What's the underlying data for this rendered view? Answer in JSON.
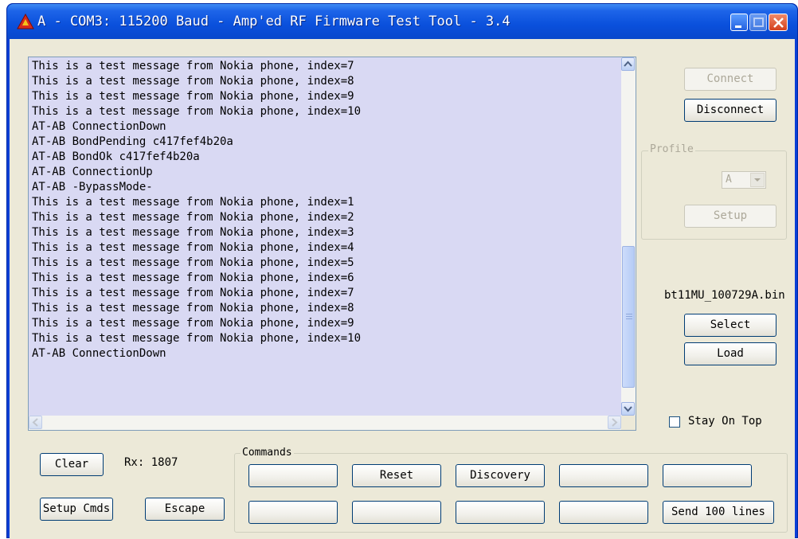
{
  "window": {
    "title": "A - COM3: 115200 Baud - Amp'ed RF Firmware Test Tool - 3.4"
  },
  "log": {
    "lines": [
      "This is a test message from Nokia phone, index=7",
      "This is a test message from Nokia phone, index=8",
      "This is a test message from Nokia phone, index=9",
      "This is a test message from Nokia phone, index=10",
      "AT-AB ConnectionDown",
      "AT-AB BondPending c417fef4b20a",
      "AT-AB BondOk c417fef4b20a",
      "AT-AB ConnectionUp",
      "AT-AB -BypassMode-",
      "This is a test message from Nokia phone, index=1",
      "This is a test message from Nokia phone, index=2",
      "This is a test message from Nokia phone, index=3",
      "This is a test message from Nokia phone, index=4",
      "This is a test message from Nokia phone, index=5",
      "This is a test message from Nokia phone, index=6",
      "This is a test message from Nokia phone, index=7",
      "This is a test message from Nokia phone, index=8",
      "This is a test message from Nokia phone, index=9",
      "This is a test message from Nokia phone, index=10",
      "AT-AB ConnectionDown"
    ]
  },
  "right_panel": {
    "connect_label": "Connect",
    "disconnect_label": "Disconnect",
    "profile_group_label": "Profile",
    "profile_value": "A",
    "setup_label": "Setup",
    "file_name": "bt11MU_100729A.bin",
    "select_label": "Select",
    "load_label": "Load",
    "stay_on_top_label": "Stay On Top"
  },
  "bottom": {
    "clear_label": "Clear",
    "rx_text": "Rx: 1807",
    "setup_cmds_label": "Setup Cmds",
    "escape_label": "Escape",
    "commands_group_label": "Commands",
    "commands_row1": [
      "",
      "Reset",
      "Discovery",
      "",
      ""
    ],
    "commands_row2": [
      "",
      "",
      "",
      "",
      "Send 100 lines"
    ]
  },
  "colors": {
    "titlebar": "#0a50dc",
    "client_bg": "#ece9d8",
    "log_bg": "#d9d9f3"
  }
}
